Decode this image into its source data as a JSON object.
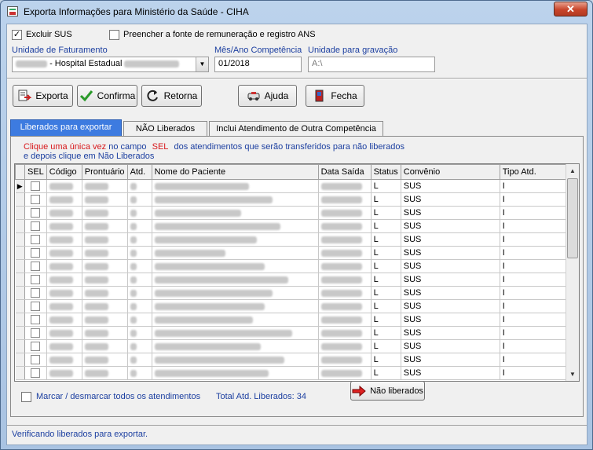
{
  "window": {
    "title": "Exporta Informações para Ministério da Saúde - CIHA",
    "close_glyph": "✕"
  },
  "options": {
    "excluir_sus": {
      "label": "Excluir SUS",
      "checked": true
    },
    "preencher_fonte": {
      "label": "Preencher a fonte de remuneração e registro ANS",
      "checked": false
    }
  },
  "fields": {
    "unidade_faturamento": {
      "label": "Unidade de Faturamento",
      "value": "- Hospital Estadual"
    },
    "mes_ano": {
      "label": "Mês/Ano Competência",
      "value": "01/2018"
    },
    "unidade_gravacao": {
      "label": "Unidade para gravação",
      "value": "A:\\"
    }
  },
  "toolbar": {
    "exporta": "Exporta",
    "confirma": "Confirma",
    "retorna": "Retorna",
    "ajuda": "Ajuda",
    "fecha": "Fecha"
  },
  "tabs": [
    {
      "label": "Liberados para exportar",
      "active": true
    },
    {
      "label": "NÃO Liberados",
      "active": false
    },
    {
      "label": "Inclui Atendimento de Outra Competência",
      "active": false
    }
  ],
  "instructions": {
    "part1": "Clique uma única vez",
    "part2": "no campo",
    "part3": "SEL",
    "part4": "dos atendimentos que serão transferidos para não liberados",
    "line2": "e depois clique em Não Liberados"
  },
  "table": {
    "columns": [
      "SEL",
      "Código",
      "Prontuário",
      "Atd.",
      "Nome do Paciente",
      "Data Saída",
      "Status",
      "Convênio",
      "Tipo Atd."
    ],
    "rows": [
      {
        "status": "L",
        "convenio": "SUS",
        "tipo": "I"
      },
      {
        "status": "L",
        "convenio": "SUS",
        "tipo": "I"
      },
      {
        "status": "L",
        "convenio": "SUS",
        "tipo": "I"
      },
      {
        "status": "L",
        "convenio": "SUS",
        "tipo": "I"
      },
      {
        "status": "L",
        "convenio": "SUS",
        "tipo": "I"
      },
      {
        "status": "L",
        "convenio": "SUS",
        "tipo": "I"
      },
      {
        "status": "L",
        "convenio": "SUS",
        "tipo": "I"
      },
      {
        "status": "L",
        "convenio": "SUS",
        "tipo": "I"
      },
      {
        "status": "L",
        "convenio": "SUS",
        "tipo": "I"
      },
      {
        "status": "L",
        "convenio": "SUS",
        "tipo": "I"
      },
      {
        "status": "L",
        "convenio": "SUS",
        "tipo": "I"
      },
      {
        "status": "L",
        "convenio": "SUS",
        "tipo": "I"
      },
      {
        "status": "L",
        "convenio": "SUS",
        "tipo": "I"
      },
      {
        "status": "L",
        "convenio": "SUS",
        "tipo": "I"
      },
      {
        "status": "L",
        "convenio": "SUS",
        "tipo": "I"
      }
    ]
  },
  "footer": {
    "marcar_label": "Marcar / desmarcar todos os atendimentos",
    "total_label": "Total Atd. Liberados: 34",
    "nao_liberados_btn": "Não liberados"
  },
  "status_bar": {
    "text": "Verificando liberados para exportar."
  }
}
